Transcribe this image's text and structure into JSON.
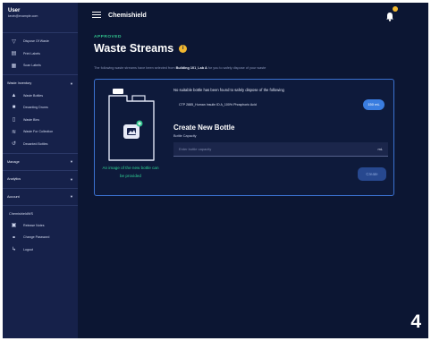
{
  "user": {
    "name": "User",
    "email": "kevin@example.com"
  },
  "sidebar": {
    "top_items": [
      {
        "icon": "filter-icon",
        "label": "Dispose Of Waste"
      },
      {
        "icon": "printer-icon",
        "label": "Print Labels"
      },
      {
        "icon": "barcode-icon",
        "label": "Scan Labels"
      }
    ],
    "waste_inventory": {
      "heading": "Waste Inventory",
      "items": [
        {
          "icon": "flask-icon",
          "label": "Waste Bottles"
        },
        {
          "icon": "truck-icon",
          "label": "Decanting Drums"
        },
        {
          "icon": "bin-icon",
          "label": "Waste Bins"
        },
        {
          "icon": "collection-icon",
          "label": "Waste For Collection"
        },
        {
          "icon": "history-icon",
          "label": "Decanted Bottles"
        }
      ]
    },
    "sections": [
      "Manage",
      "Analytics",
      "Account"
    ],
    "product": "ChemishieldWS",
    "bottom_items": [
      {
        "icon": "notes-icon",
        "label": "Release Notes"
      },
      {
        "icon": "key-icon",
        "label": "Change Password"
      },
      {
        "icon": "logout-icon",
        "label": "Logout"
      }
    ]
  },
  "header": {
    "app_title": "Chemishield"
  },
  "page": {
    "status": "APPROVED",
    "title": "Waste Streams",
    "subtitle_pre": "The following waste streams have been selected from",
    "subtitle_location": "Building 101_Lab A",
    "subtitle_post": "for you to safely dispose of your waste"
  },
  "card": {
    "not_found_text": "No suitable bottle has been found to safely dispose of the following",
    "waste_label": "CTP 2885_Human Insulin ID A_100% Phosphoric Acid",
    "volume": "150 mL",
    "image_caption": "An image of the new bottle can be provided",
    "create_title": "Create New Bottle",
    "capacity_label": "Bottle Capacity",
    "capacity_placeholder": "Enter bottle capacity",
    "capacity_value": "",
    "unit": "mL",
    "create_button": "Create"
  },
  "step_number": "4",
  "colors": {
    "accent": "#3a7de0",
    "success": "#31c48d",
    "warning": "#f2b830",
    "background": "#0c1633",
    "sidebar": "#16214a"
  }
}
